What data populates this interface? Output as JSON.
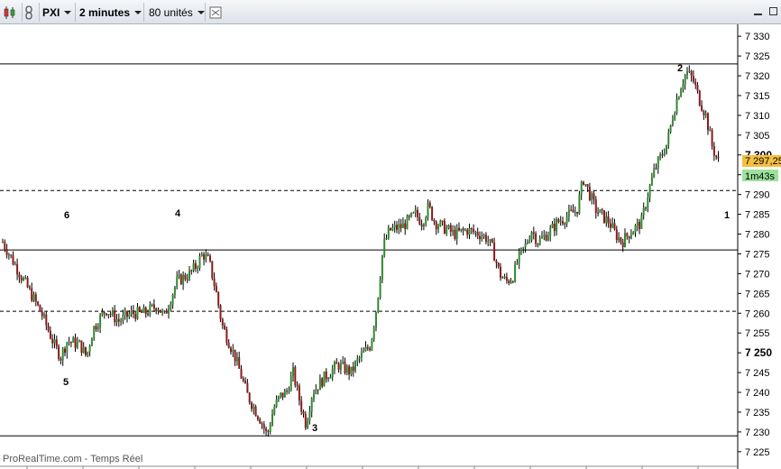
{
  "toolbar": {
    "instrument": "PXI",
    "timeframe": "2 minutes",
    "units": "80 unités"
  },
  "footer": {
    "source": "ProRealTime.com - Temps Réel"
  },
  "colors": {
    "up": "#2f8a2f",
    "down": "#8b1a1a",
    "price_tag": "#f4c040",
    "timer_tag": "#9be39b"
  },
  "chart_data": {
    "type": "candlestick",
    "ylim": [
      7222,
      7333
    ],
    "y_ticks": [
      "7 330",
      "7 325",
      "7 320",
      "7 315",
      "7 310",
      "7 305",
      "7 300",
      "7 295",
      "7 290",
      "7 285",
      "7 280",
      "7 275",
      "7 270",
      "7 265",
      "7 260",
      "7 255",
      "7 250",
      "7 245",
      "7 240",
      "7 235",
      "7 230",
      "7 225"
    ],
    "y_tick_values": [
      7330,
      7325,
      7320,
      7315,
      7310,
      7305,
      7300,
      7295,
      7290,
      7285,
      7280,
      7275,
      7270,
      7265,
      7260,
      7255,
      7250,
      7245,
      7240,
      7235,
      7230,
      7225
    ],
    "bold_ticks": [
      "7 300",
      "7 250"
    ],
    "last_price": "7 297,25",
    "timer": "1m43s",
    "bar_count": 80,
    "close_path": [
      [
        0,
        7278
      ],
      [
        2,
        7272
      ],
      [
        4,
        7266
      ],
      [
        6,
        7260
      ],
      [
        8,
        7252
      ],
      [
        9,
        7249
      ],
      [
        10,
        7253
      ],
      [
        12,
        7252
      ],
      [
        13,
        7249
      ],
      [
        14,
        7256
      ],
      [
        16,
        7261
      ],
      [
        18,
        7258
      ],
      [
        20,
        7260
      ],
      [
        22,
        7260
      ],
      [
        24,
        7262
      ],
      [
        25,
        7259
      ],
      [
        27,
        7268
      ],
      [
        29,
        7270
      ],
      [
        30,
        7272
      ],
      [
        31,
        7275
      ],
      [
        32,
        7273
      ],
      [
        33,
        7266
      ],
      [
        34,
        7257
      ],
      [
        36,
        7249
      ],
      [
        38,
        7239
      ],
      [
        40,
        7233
      ],
      [
        41,
        7229
      ],
      [
        42,
        7236
      ],
      [
        43,
        7239
      ],
      [
        44,
        7240
      ],
      [
        45,
        7245
      ],
      [
        46,
        7238
      ],
      [
        47,
        7232
      ],
      [
        48,
        7240
      ],
      [
        50,
        7244
      ],
      [
        52,
        7247
      ],
      [
        54,
        7245
      ],
      [
        55,
        7248
      ],
      [
        57,
        7252
      ],
      [
        58,
        7262
      ],
      [
        59,
        7277
      ],
      [
        60,
        7281
      ],
      [
        62,
        7282
      ],
      [
        64,
        7285
      ],
      [
        65,
        7283
      ],
      [
        66,
        7287
      ],
      [
        67,
        7283
      ],
      [
        68,
        7282
      ],
      [
        69,
        7281
      ],
      [
        70,
        7280
      ],
      [
        72,
        7281
      ],
      [
        74,
        7280
      ],
      [
        75,
        7279
      ],
      [
        76,
        7276
      ],
      [
        77,
        7270
      ],
      [
        78,
        7268
      ],
      [
        79,
        7269
      ],
      [
        80,
        7274
      ],
      [
        81,
        7277
      ],
      [
        82,
        7281
      ],
      [
        83,
        7278
      ],
      [
        85,
        7281
      ],
      [
        86,
        7283
      ],
      [
        88,
        7285
      ],
      [
        89,
        7286
      ],
      [
        90,
        7294
      ],
      [
        92,
        7286
      ],
      [
        94,
        7283
      ],
      [
        95,
        7280
      ],
      [
        96,
        7278
      ],
      [
        97,
        7280
      ],
      [
        99,
        7283
      ],
      [
        100,
        7290
      ],
      [
        101,
        7296
      ],
      [
        103,
        7303
      ],
      [
        104,
        7311
      ],
      [
        105,
        7317
      ],
      [
        106,
        7321
      ],
      [
        107,
        7319
      ],
      [
        108,
        7314
      ],
      [
        109,
        7310
      ],
      [
        110,
        7302
      ],
      [
        111,
        7298
      ]
    ],
    "hlines": [
      {
        "y": 7323.0,
        "style": "solid"
      },
      {
        "y": 7291.0,
        "style": "dashed"
      },
      {
        "y": 7276.0,
        "style": "solid"
      },
      {
        "y": 7260.5,
        "style": "dashed"
      },
      {
        "y": 7229.0,
        "style": "solid"
      }
    ],
    "annotations": [
      {
        "text": "1",
        "x": 7323.0
      },
      {
        "text": "2",
        "x": 7323.0
      },
      {
        "text": "3",
        "x": 7229.0
      },
      {
        "text": "4",
        "x": 7276.0
      },
      {
        "text": "5",
        "x": 7244.0
      },
      {
        "text": "6",
        "x": 7276.0
      }
    ]
  }
}
